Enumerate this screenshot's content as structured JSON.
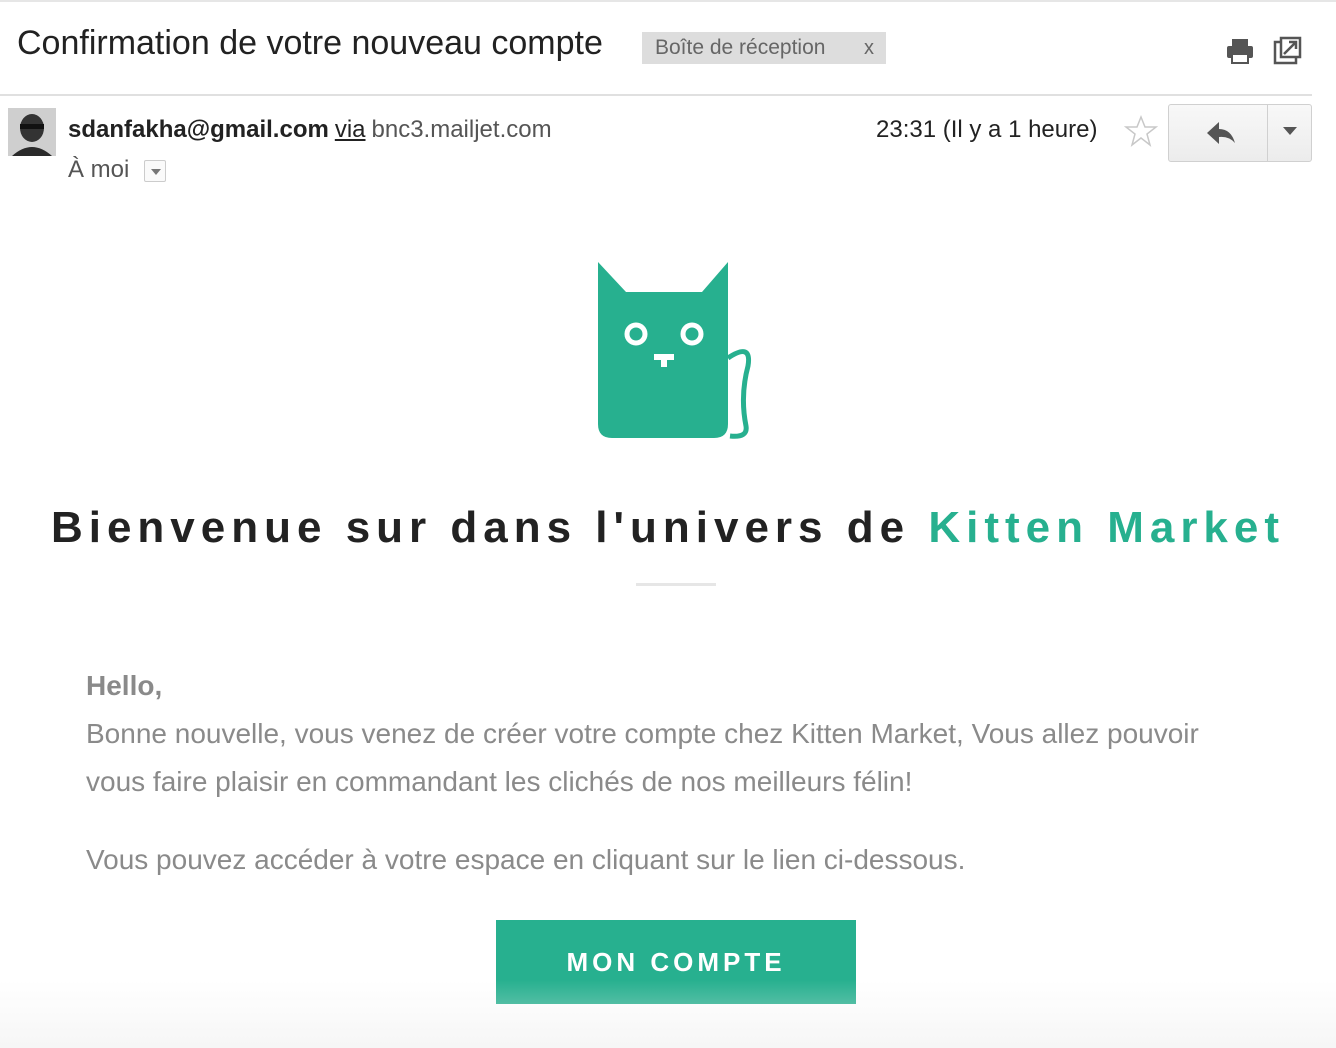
{
  "message": {
    "subject": "Confirmation de votre nouveau compte",
    "label": "Boîte de réception",
    "label_remove": "x",
    "sender_email": "sdanfakha@gmail.com",
    "via": "via",
    "via_domain": "bnc3.mailjet.com",
    "to": "À moi",
    "time": "23:31 (Il y a 1 heure)"
  },
  "content": {
    "headline_prefix": "Bienvenue sur dans l'univers de ",
    "headline_brand": "Kitten Market",
    "greeting": "Hello,",
    "paragraph1": "Bonne nouvelle, vous venez de créer votre compte chez Kitten Market, Vous allez pouvoir vous faire plaisir en commandant les clichés de nos meilleurs félin!",
    "paragraph2": "Vous pouvez accéder à votre espace en cliquant sur le lien ci-dessous.",
    "cta_label": "MON COMPTE"
  },
  "icons": {
    "print": "print-icon",
    "new_window": "open-in-new-window-icon",
    "star": "star-icon",
    "reply": "reply-icon",
    "more": "chevron-down-icon",
    "logo": "cat-logo-icon"
  },
  "colors": {
    "brand": "#27b08f",
    "text": "#222222",
    "muted": "#8a8a8a"
  }
}
